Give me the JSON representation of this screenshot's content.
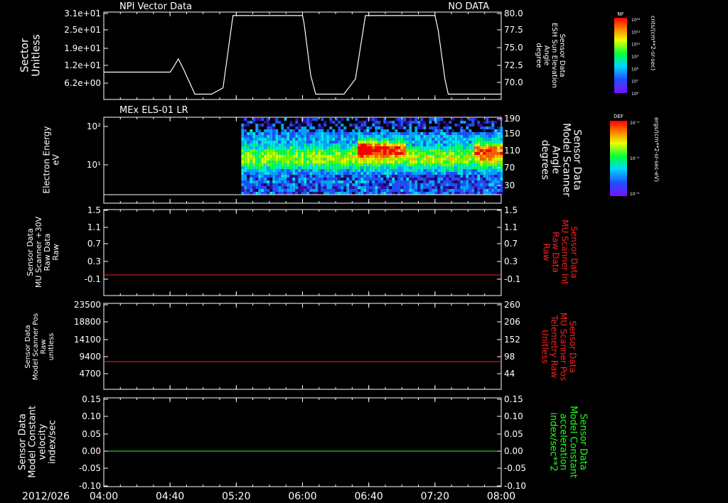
{
  "header": {
    "left_title": "NPI Vector Data",
    "right_title": "NO DATA",
    "panel2_title": "MEx ELS-01 LR"
  },
  "time_axis": {
    "date_label": "2012/026",
    "ticks": [
      "04:00",
      "04:40",
      "05:20",
      "06:00",
      "06:40",
      "07:20",
      "08:00"
    ]
  },
  "colorbars": [
    {
      "label": "NF",
      "units": "cnts/(cm**2-sr-sec)",
      "ticks": [
        "10¹²",
        "10¹¹",
        "10¹⁰",
        "10⁹",
        "10⁸",
        "10⁷",
        "10⁶"
      ]
    },
    {
      "label": "DEF",
      "units": "ergs/(cm**2-sr-sec-eV)",
      "ticks": [
        "10⁻⁴",
        "10⁻⁵",
        "10⁻⁶"
      ]
    }
  ],
  "colors": {
    "line_white": "#ffffff",
    "line_red": "#ff2020",
    "line_green": "#20ff20"
  },
  "chart_data": [
    {
      "type": "line",
      "left_ylabel": [
        "Sector",
        "Unitless"
      ],
      "left_ticks": [
        "3.1e+01",
        "2.5e+01",
        "1.9e+01",
        "1.2e+01",
        "6.2e+00"
      ],
      "right_ylabel": [
        "Sensor Data",
        "ESH Sun Elevation",
        "Angle",
        "degree"
      ],
      "right_ticks": [
        "80.0",
        "77.5",
        "75.0",
        "72.5",
        "70.0"
      ],
      "right_ylim": [
        68,
        80
      ],
      "x": [
        "04:00",
        "04:40",
        "04:41",
        "04:45",
        "04:48",
        "04:55",
        "05:05",
        "05:12",
        "05:18",
        "05:30",
        "06:00",
        "06:01",
        "06:05",
        "06:08",
        "06:15",
        "06:25",
        "06:32",
        "06:38",
        "06:50",
        "07:20",
        "07:22",
        "07:26",
        "07:28",
        "07:35",
        "08:00"
      ],
      "values": [
        71.5,
        71.5,
        71.8,
        73.4,
        72.0,
        68.3,
        68.3,
        69.2,
        79.7,
        79.7,
        79.7,
        78.5,
        71.0,
        68.3,
        68.3,
        68.3,
        70.5,
        79.7,
        79.7,
        79.7,
        77.5,
        70.5,
        68.3,
        68.3,
        68.3
      ]
    },
    {
      "type": "heatmap",
      "left_ylabel": [
        "Electron Energy",
        "eV"
      ],
      "left_ticks": [
        "10²",
        "10¹"
      ],
      "right_ylabel": [
        "Sensor Data",
        "Model Scanner",
        "Angle",
        "degrees"
      ],
      "right_ticks": [
        "190",
        "150",
        "110",
        "70",
        "30"
      ],
      "data_start": "05:23",
      "features": [
        {
          "start": "05:23",
          "end": "06:33",
          "energy_band_eV": [
            5,
            30
          ],
          "level": "moderate"
        },
        {
          "start": "06:33",
          "end": "07:02",
          "energy_band_eV": [
            10,
            50
          ],
          "level": "high"
        },
        {
          "start": "07:43",
          "end": "08:00",
          "energy_band_eV": [
            8,
            60
          ],
          "level": "high"
        }
      ]
    },
    {
      "type": "line",
      "left_ylabel": [
        "Sensor Data",
        "MU Scanner +30V",
        "Raw Data",
        "Raw"
      ],
      "left_ticks": [
        "1.5",
        "1.1",
        "0.7",
        "0.3",
        "-0.1"
      ],
      "right_ylabel": [
        "Sensor Data",
        "MU Scanner Int",
        "Raw Data",
        "Raw"
      ],
      "right_ticks": [
        "1.5",
        "1.1",
        "0.7",
        "0.3",
        "-0.1"
      ],
      "ylim": [
        -0.35,
        1.5
      ],
      "series": [
        {
          "color": "#ff2020",
          "x": [
            "04:00",
            "08:00"
          ],
          "values": [
            0,
            0
          ]
        }
      ]
    },
    {
      "type": "line",
      "left_ylabel": [
        "Sensor Data",
        "Model Scanner Pos",
        "Raw",
        "unitless"
      ],
      "left_ticks": [
        "23500",
        "18800",
        "14100",
        "9400",
        "4700"
      ],
      "right_ylabel": [
        "Sensor Data",
        "MU Scanner Pos",
        "Telemetry Raw",
        "Unitless"
      ],
      "right_ticks": [
        "260",
        "206",
        "152",
        "98",
        "44"
      ],
      "ylim": [
        0,
        23500
      ],
      "series": [
        {
          "color": "#ff2020",
          "x": [
            "04:00",
            "08:00"
          ],
          "values": [
            8000,
            8000
          ]
        }
      ]
    },
    {
      "type": "line",
      "left_ylabel": [
        "Sensor Data",
        "Model Constant",
        "velocity",
        "index/sec"
      ],
      "left_ticks": [
        "0.15",
        "0.10",
        "0.05",
        "0.00",
        "-0.05",
        "-0.10"
      ],
      "right_ylabel": [
        "Sensor Data",
        "Model Constant",
        "acceleration",
        "index/sec**2"
      ],
      "right_ticks": [
        "0.15",
        "0.10",
        "0.05",
        "0.00",
        "-0.05",
        "-0.10"
      ],
      "ylim": [
        -0.1,
        0.15
      ],
      "series": [
        {
          "color": "#20ff20",
          "x": [
            "04:00",
            "08:00"
          ],
          "values": [
            0,
            0
          ]
        }
      ]
    }
  ]
}
